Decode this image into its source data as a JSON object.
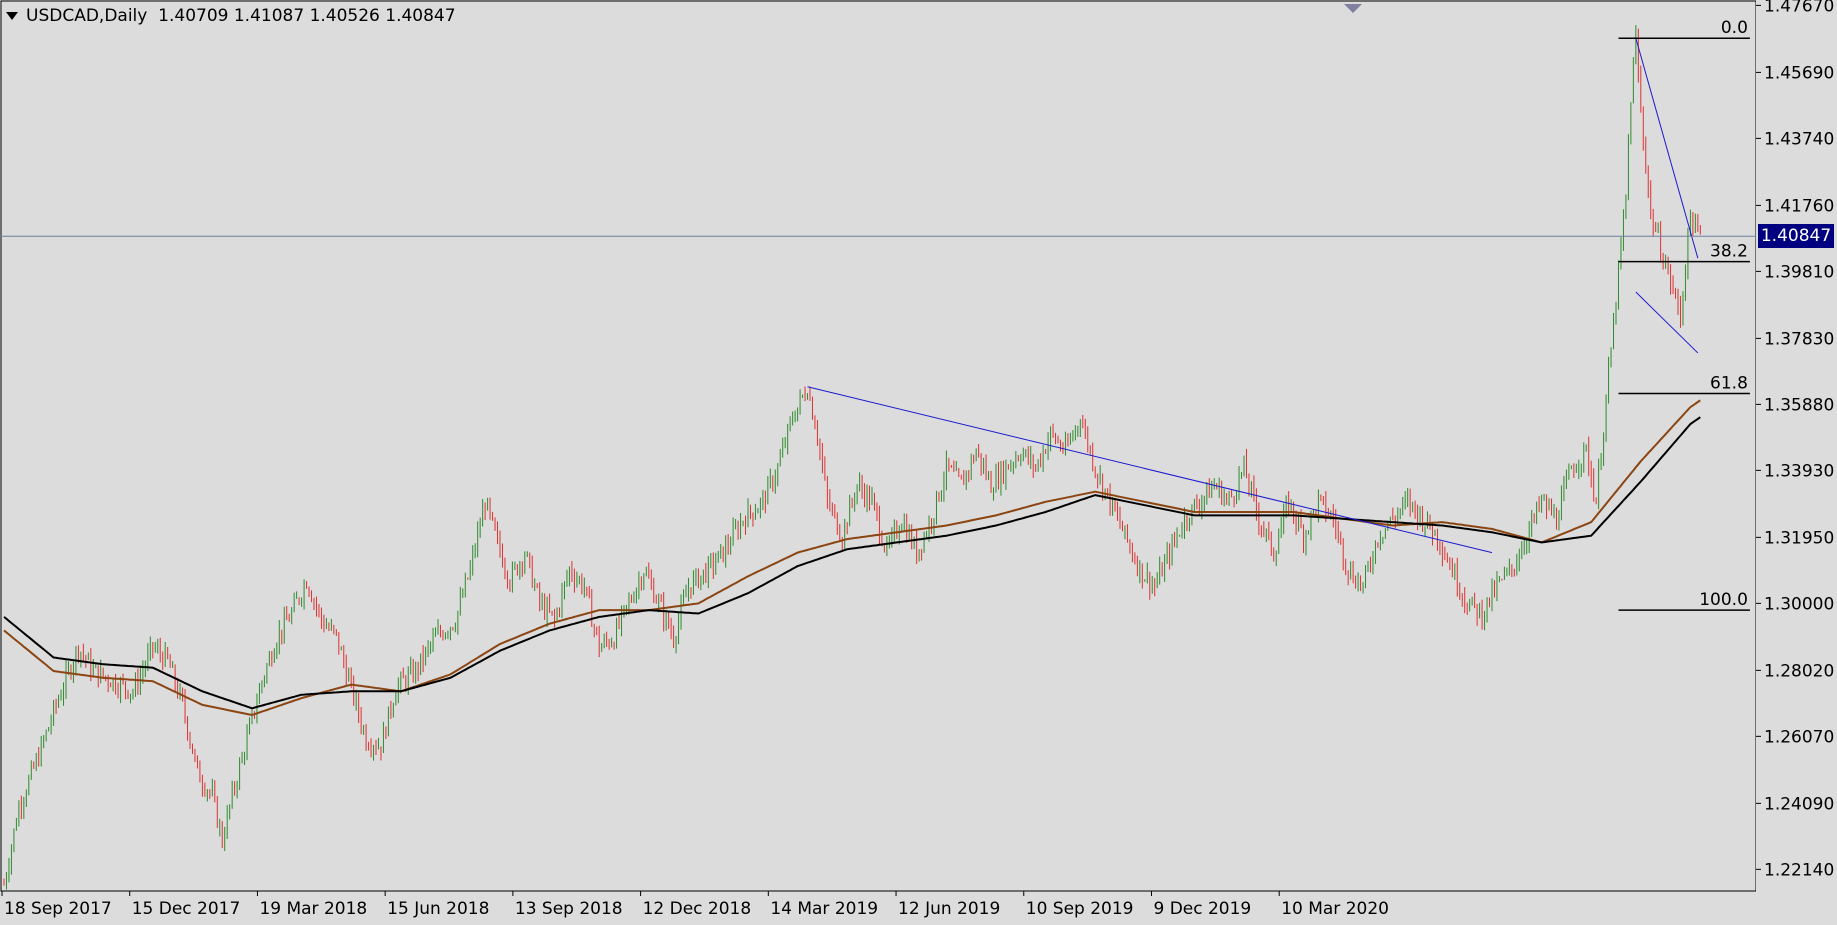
{
  "header": {
    "symbol": "USDCAD,Daily",
    "ohlc": "1.40709 1.41087 1.40526 1.40847"
  },
  "current_price": "1.40847",
  "colors": {
    "background": "#dcdcdc",
    "bull_candle": "#2e8b2e",
    "bear_candle": "#e03030",
    "ma_fast": "#8b4513",
    "ma_slow": "#000000",
    "trendline": "#1a1ad0",
    "price_badge": "#000080"
  },
  "chart_data": {
    "type": "candlestick",
    "symbol": "USDCAD",
    "timeframe": "Daily",
    "y_ticks": [
      "1.47670",
      "1.45690",
      "1.43740",
      "1.41760",
      "1.39810",
      "1.37830",
      "1.35880",
      "1.33930",
      "1.31950",
      "1.30000",
      "1.28020",
      "1.26070",
      "1.24090",
      "1.22140"
    ],
    "x_ticks": [
      "18 Sep 2017",
      "15 Dec 2017",
      "19 Mar 2018",
      "15 Jun 2018",
      "13 Sep 2018",
      "12 Dec 2018",
      "14 Mar 2019",
      "12 Jun 2019",
      "10 Sep 2019",
      "9 Dec 2019",
      "10 Mar 2020"
    ],
    "ylim": [
      1.215,
      1.478
    ],
    "price_path": [
      [
        0,
        1.217
      ],
      [
        6,
        1.24
      ],
      [
        14,
        1.255
      ],
      [
        22,
        1.272
      ],
      [
        30,
        1.287
      ],
      [
        36,
        1.28
      ],
      [
        44,
        1.277
      ],
      [
        52,
        1.274
      ],
      [
        60,
        1.287
      ],
      [
        66,
        1.283
      ],
      [
        72,
        1.27
      ],
      [
        78,
        1.25
      ],
      [
        84,
        1.243
      ],
      [
        88,
        1.23
      ],
      [
        92,
        1.243
      ],
      [
        98,
        1.26
      ],
      [
        104,
        1.277
      ],
      [
        110,
        1.29
      ],
      [
        116,
        1.297
      ],
      [
        122,
        1.307
      ],
      [
        128,
        1.295
      ],
      [
        134,
        1.29
      ],
      [
        140,
        1.275
      ],
      [
        146,
        1.26
      ],
      [
        152,
        1.258
      ],
      [
        158,
        1.275
      ],
      [
        166,
        1.28
      ],
      [
        174,
        1.29
      ],
      [
        182,
        1.295
      ],
      [
        188,
        1.31
      ],
      [
        194,
        1.33
      ],
      [
        198,
        1.32
      ],
      [
        204,
        1.307
      ],
      [
        210,
        1.315
      ],
      [
        216,
        1.3
      ],
      [
        222,
        1.295
      ],
      [
        228,
        1.31
      ],
      [
        234,
        1.305
      ],
      [
        240,
        1.287
      ],
      [
        246,
        1.29
      ],
      [
        252,
        1.3
      ],
      [
        258,
        1.31
      ],
      [
        264,
        1.3
      ],
      [
        270,
        1.29
      ],
      [
        276,
        1.305
      ],
      [
        284,
        1.31
      ],
      [
        290,
        1.315
      ],
      [
        298,
        1.325
      ],
      [
        306,
        1.33
      ],
      [
        312,
        1.34
      ],
      [
        318,
        1.355
      ],
      [
        324,
        1.364
      ],
      [
        328,
        1.35
      ],
      [
        332,
        1.33
      ],
      [
        338,
        1.32
      ],
      [
        344,
        1.335
      ],
      [
        350,
        1.33
      ],
      [
        356,
        1.315
      ],
      [
        362,
        1.325
      ],
      [
        368,
        1.315
      ],
      [
        374,
        1.325
      ],
      [
        380,
        1.34
      ],
      [
        386,
        1.335
      ],
      [
        392,
        1.345
      ],
      [
        398,
        1.335
      ],
      [
        404,
        1.34
      ],
      [
        410,
        1.345
      ],
      [
        416,
        1.34
      ],
      [
        422,
        1.35
      ],
      [
        428,
        1.345
      ],
      [
        434,
        1.355
      ],
      [
        440,
        1.34
      ],
      [
        446,
        1.33
      ],
      [
        452,
        1.32
      ],
      [
        458,
        1.31
      ],
      [
        464,
        1.305
      ],
      [
        470,
        1.315
      ],
      [
        476,
        1.325
      ],
      [
        482,
        1.33
      ],
      [
        488,
        1.335
      ],
      [
        494,
        1.33
      ],
      [
        500,
        1.34
      ],
      [
        506,
        1.325
      ],
      [
        512,
        1.315
      ],
      [
        518,
        1.33
      ],
      [
        524,
        1.32
      ],
      [
        530,
        1.33
      ],
      [
        536,
        1.325
      ],
      [
        542,
        1.31
      ],
      [
        548,
        1.305
      ],
      [
        554,
        1.32
      ],
      [
        560,
        1.325
      ],
      [
        566,
        1.33
      ],
      [
        572,
        1.325
      ],
      [
        578,
        1.32
      ],
      [
        584,
        1.31
      ],
      [
        590,
        1.3
      ],
      [
        596,
        1.297
      ],
      [
        602,
        1.305
      ],
      [
        608,
        1.31
      ],
      [
        614,
        1.32
      ],
      [
        620,
        1.33
      ],
      [
        626,
        1.325
      ],
      [
        632,
        1.34
      ],
      [
        638,
        1.345
      ],
      [
        642,
        1.33
      ],
      [
        646,
        1.36
      ],
      [
        650,
        1.39
      ],
      [
        654,
        1.42
      ],
      [
        656,
        1.45
      ],
      [
        658,
        1.467
      ],
      [
        660,
        1.445
      ],
      [
        662,
        1.43
      ],
      [
        664,
        1.415
      ],
      [
        666,
        1.41
      ],
      [
        668,
        1.405
      ],
      [
        670,
        1.4
      ],
      [
        672,
        1.395
      ],
      [
        674,
        1.39
      ],
      [
        676,
        1.385
      ],
      [
        678,
        1.4
      ],
      [
        680,
        1.415
      ],
      [
        682,
        1.41
      ],
      [
        684,
        1.4085
      ]
    ],
    "moving_averages": [
      {
        "color": "#8b4513",
        "path": [
          [
            0,
            1.292
          ],
          [
            20,
            1.28
          ],
          [
            40,
            1.278
          ],
          [
            60,
            1.277
          ],
          [
            80,
            1.27
          ],
          [
            100,
            1.267
          ],
          [
            120,
            1.272
          ],
          [
            140,
            1.276
          ],
          [
            160,
            1.274
          ],
          [
            180,
            1.279
          ],
          [
            200,
            1.288
          ],
          [
            220,
            1.294
          ],
          [
            240,
            1.298
          ],
          [
            260,
            1.298
          ],
          [
            280,
            1.3
          ],
          [
            300,
            1.308
          ],
          [
            320,
            1.315
          ],
          [
            340,
            1.319
          ],
          [
            360,
            1.321
          ],
          [
            380,
            1.323
          ],
          [
            400,
            1.326
          ],
          [
            420,
            1.33
          ],
          [
            440,
            1.333
          ],
          [
            460,
            1.33
          ],
          [
            480,
            1.327
          ],
          [
            500,
            1.327
          ],
          [
            520,
            1.327
          ],
          [
            540,
            1.325
          ],
          [
            560,
            1.323
          ],
          [
            580,
            1.324
          ],
          [
            600,
            1.322
          ],
          [
            620,
            1.318
          ],
          [
            640,
            1.324
          ],
          [
            660,
            1.342
          ],
          [
            680,
            1.358
          ],
          [
            684,
            1.36
          ]
        ]
      },
      {
        "color": "#000000",
        "path": [
          [
            0,
            1.296
          ],
          [
            20,
            1.284
          ],
          [
            40,
            1.282
          ],
          [
            60,
            1.281
          ],
          [
            80,
            1.274
          ],
          [
            100,
            1.269
          ],
          [
            120,
            1.273
          ],
          [
            140,
            1.274
          ],
          [
            160,
            1.274
          ],
          [
            180,
            1.278
          ],
          [
            200,
            1.286
          ],
          [
            220,
            1.292
          ],
          [
            240,
            1.296
          ],
          [
            260,
            1.298
          ],
          [
            280,
            1.297
          ],
          [
            300,
            1.303
          ],
          [
            320,
            1.311
          ],
          [
            340,
            1.316
          ],
          [
            360,
            1.318
          ],
          [
            380,
            1.32
          ],
          [
            400,
            1.323
          ],
          [
            420,
            1.327
          ],
          [
            440,
            1.332
          ],
          [
            460,
            1.329
          ],
          [
            480,
            1.326
          ],
          [
            500,
            1.326
          ],
          [
            520,
            1.326
          ],
          [
            540,
            1.325
          ],
          [
            560,
            1.324
          ],
          [
            580,
            1.323
          ],
          [
            600,
            1.321
          ],
          [
            620,
            1.318
          ],
          [
            640,
            1.32
          ],
          [
            660,
            1.336
          ],
          [
            680,
            1.353
          ],
          [
            684,
            1.355
          ]
        ]
      }
    ],
    "trendlines": [
      {
        "from": [
          324,
          1.364
        ],
        "to": [
          600,
          1.315
        ]
      },
      {
        "from": [
          658,
          1.467
        ],
        "to": [
          683,
          1.402
        ]
      },
      {
        "from": [
          658,
          1.392
        ],
        "to": [
          683,
          1.374
        ]
      }
    ],
    "fibonacci": [
      {
        "label": "0.0",
        "price": 1.467
      },
      {
        "label": "38.2",
        "price": 1.401
      },
      {
        "label": "61.8",
        "price": 1.362
      },
      {
        "label": "100.0",
        "price": 1.298
      }
    ]
  }
}
